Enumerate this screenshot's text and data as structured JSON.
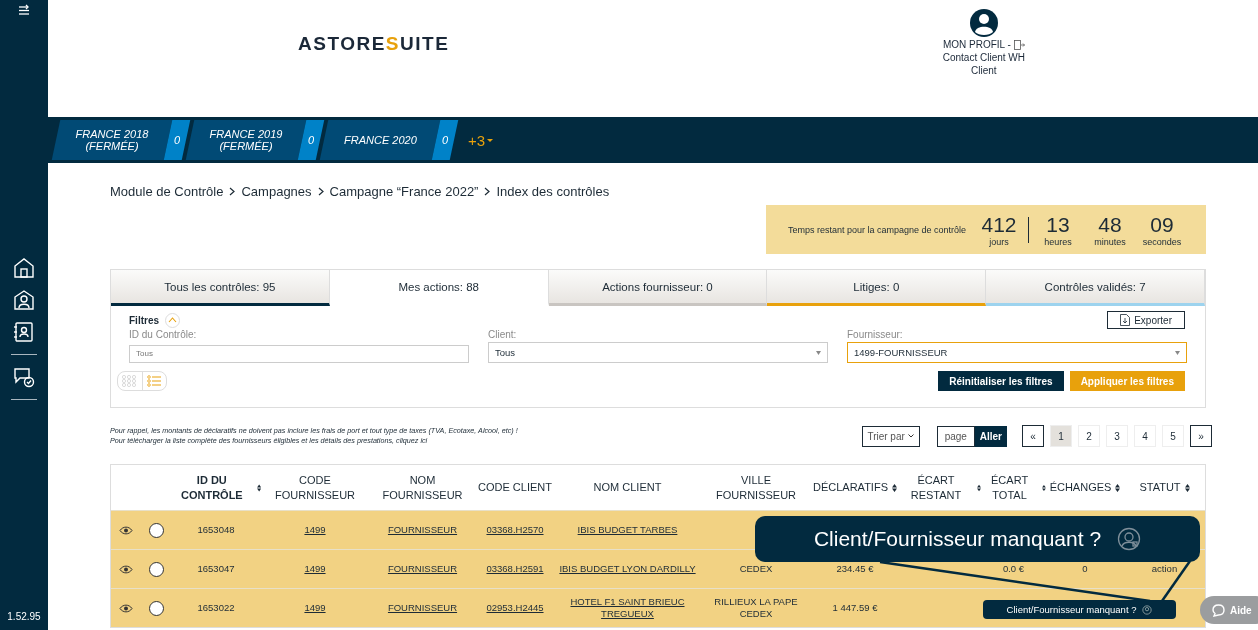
{
  "sidebar": {
    "version": "1.52.95"
  },
  "header": {
    "logo_left": "ASTORE",
    "logo_mark": "S",
    "logo_right": "UITE",
    "profile_link": "MON PROFIL -",
    "profile_name": "Contact Client WH",
    "profile_role": "Client"
  },
  "campaigns": [
    {
      "label": "FRANCE 2018 (FERMÉE)",
      "count": "0"
    },
    {
      "label": "FRANCE 2019 (FERMÉE)",
      "count": "0"
    },
    {
      "label": "FRANCE 2020",
      "count": "0"
    }
  ],
  "more_campaigns": "+3",
  "breadcrumb": [
    "Module de Contrôle",
    "Campagnes",
    "Campagne “France 2022”",
    "Index des contrôles"
  ],
  "timer": {
    "label": "Temps restant pour la campagne de contrôle",
    "units": [
      {
        "value": "412",
        "unit": "jours"
      },
      {
        "value": "13",
        "unit": "heures"
      },
      {
        "value": "48",
        "unit": "minutes"
      },
      {
        "value": "09",
        "unit": "secondes"
      }
    ]
  },
  "tabs": [
    {
      "label": "Tous les contrôles: 95",
      "selected": false,
      "color": "#022a3f"
    },
    {
      "label": "Mes actions: 88",
      "selected": true
    },
    {
      "label": "Actions fournisseur: 0",
      "selected": false,
      "color": "#c9c5c1"
    },
    {
      "label": "Litiges: 0",
      "selected": false,
      "color": "#e8a10c"
    },
    {
      "label": "Contrôles validés: 7",
      "selected": false,
      "color": "#9dd3ee"
    }
  ],
  "filters": {
    "title": "Filtres",
    "expanded": true,
    "export": "Exporter",
    "fields": [
      {
        "label": "ID du Contrôle:",
        "placeholder": "Tous",
        "kind": "input"
      },
      {
        "label": "Client:",
        "value": "Tous",
        "kind": "select"
      },
      {
        "label": "Fournisseur:",
        "value": "1499-FOURNISSEUR",
        "kind": "select",
        "highlighted": true
      }
    ],
    "views": [
      {
        "kind": "grid",
        "selected": false
      },
      {
        "kind": "list",
        "selected": true
      }
    ],
    "reset": "Réinitialiser les filtres",
    "apply": "Appliquer les filtres"
  },
  "notes": [
    "Pour rappel, les montants de déclaratifs ne doivent pas inclure les frais de port et tout type de taxes (TVA, Ecotaxe, Alcool, etc) !",
    "Pour télécharger la liste complète des fournisseurs éligibles et les détails des prestations, cliquez ici"
  ],
  "sort": "Trier par",
  "page_input": {
    "placeholder": "page",
    "button": "Aller"
  },
  "pagination": {
    "first": "«",
    "last": "»",
    "pages": [
      {
        "label": "1",
        "selected": true
      },
      {
        "label": "2",
        "selected": false
      },
      {
        "label": "3",
        "selected": false
      },
      {
        "label": "4",
        "selected": false
      },
      {
        "label": "5",
        "selected": false
      }
    ]
  },
  "table": {
    "columns": [
      {
        "label": "ID DU CONTRÔLE",
        "sortable": true,
        "bold": true
      },
      {
        "label": "CODE FOURNISSEUR",
        "sortable": false
      },
      {
        "label": "NOM FOURNISSEUR",
        "sortable": false
      },
      {
        "label": "CODE CLIENT",
        "sortable": false
      },
      {
        "label": "NOM CLIENT",
        "sortable": false
      },
      {
        "label": "VILLE FOURNISSEUR",
        "sortable": false
      },
      {
        "label": "DÉCLARATIFS",
        "sortable": true
      },
      {
        "label": "ÉCART RESTANT",
        "sortable": true
      },
      {
        "label": "ÉCART TOTAL",
        "sortable": true
      },
      {
        "label": "ÉCHANGES",
        "sortable": true
      },
      {
        "label": "STATUT",
        "sortable": true
      }
    ],
    "rows": [
      {
        "checked": false,
        "cells": [
          "1653048",
          "1499",
          "FOURNISSEUR",
          "03368.H2570",
          "IBIS BUDGET TARBES",
          "",
          "",
          "",
          "",
          "",
          ""
        ]
      },
      {
        "checked": false,
        "cells": [
          "1653047",
          "1499",
          "FOURNISSEUR",
          "03368.H2591",
          "IBIS BUDGET LYON DARDILLY",
          "CEDEX",
          "234.45 €",
          "",
          "0.0 €",
          "0",
          "action"
        ]
      },
      {
        "checked": false,
        "cells": [
          "1653022",
          "1499",
          "FOURNISSEUR",
          "02953.H2445",
          "HOTEL F1 SAINT BRIEUC TREGUEUX",
          "RILLIEUX LA PAPE CEDEX",
          "1 447.59 €",
          "",
          "",
          "",
          ""
        ]
      }
    ]
  },
  "missing_button": "Client/Fournisseur manquant ?",
  "callout": "Client/Fournisseur manquant ?",
  "help": "Aide"
}
